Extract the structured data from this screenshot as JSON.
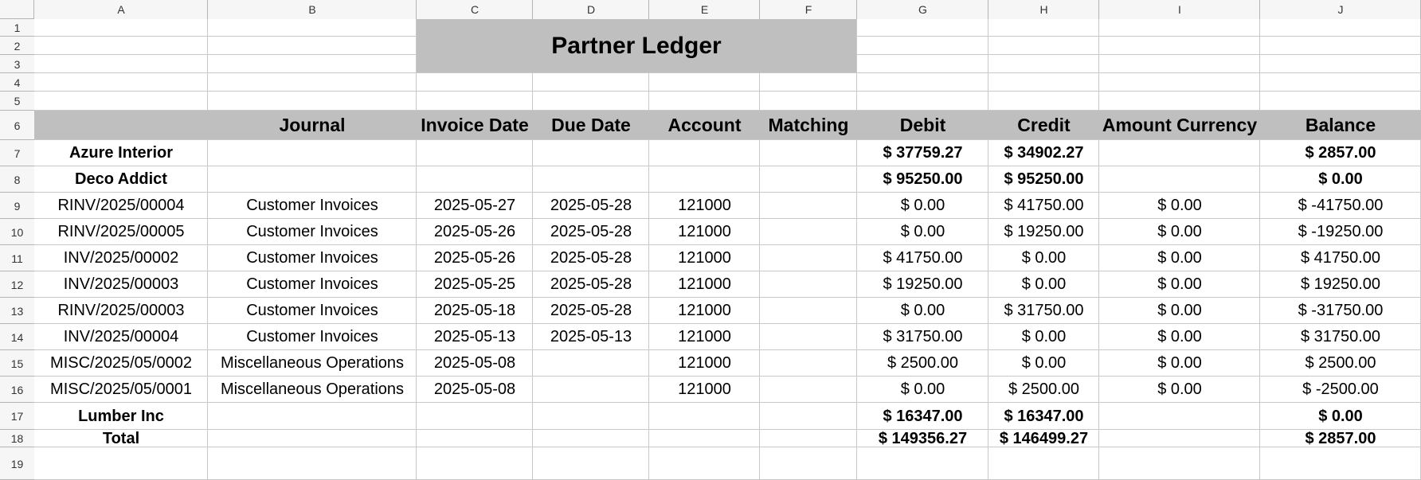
{
  "sheet": {
    "column_headers": [
      "A",
      "B",
      "C",
      "D",
      "E",
      "F",
      "G",
      "H",
      "I",
      "J"
    ],
    "row_numbers": [
      "1",
      "2",
      "3",
      "4",
      "5",
      "6",
      "7",
      "8",
      "9",
      "10",
      "11",
      "12",
      "13",
      "14",
      "15",
      "16",
      "17",
      "18",
      "19"
    ]
  },
  "report": {
    "title": "Partner Ledger",
    "columns": [
      "",
      "Journal",
      "Invoice Date",
      "Due Date",
      "Account",
      "Matching",
      "Debit",
      "Credit",
      "Amount Currency",
      "Balance"
    ],
    "rows": [
      {
        "kind": "partner",
        "cells": [
          "Azure Interior",
          "",
          "",
          "",
          "",
          "",
          "$ 37759.27",
          "$ 34902.27",
          "",
          "$ 2857.00"
        ]
      },
      {
        "kind": "partner",
        "cells": [
          "Deco Addict",
          "",
          "",
          "",
          "",
          "",
          "$ 95250.00",
          "$ 95250.00",
          "",
          "$ 0.00"
        ]
      },
      {
        "kind": "line",
        "cells": [
          "RINV/2025/00004",
          "Customer Invoices",
          "2025-05-27",
          "2025-05-28",
          "121000",
          "",
          "$ 0.00",
          "$ 41750.00",
          "$ 0.00",
          "$ -41750.00"
        ]
      },
      {
        "kind": "line",
        "cells": [
          "RINV/2025/00005",
          "Customer Invoices",
          "2025-05-26",
          "2025-05-28",
          "121000",
          "",
          "$ 0.00",
          "$ 19250.00",
          "$ 0.00",
          "$ -19250.00"
        ]
      },
      {
        "kind": "line",
        "cells": [
          "INV/2025/00002",
          "Customer Invoices",
          "2025-05-26",
          "2025-05-28",
          "121000",
          "",
          "$ 41750.00",
          "$ 0.00",
          "$ 0.00",
          "$ 41750.00"
        ]
      },
      {
        "kind": "line",
        "cells": [
          "INV/2025/00003",
          "Customer Invoices",
          "2025-05-25",
          "2025-05-28",
          "121000",
          "",
          "$ 19250.00",
          "$ 0.00",
          "$ 0.00",
          "$ 19250.00"
        ]
      },
      {
        "kind": "line",
        "cells": [
          "RINV/2025/00003",
          "Customer Invoices",
          "2025-05-18",
          "2025-05-28",
          "121000",
          "",
          "$ 0.00",
          "$ 31750.00",
          "$ 0.00",
          "$ -31750.00"
        ]
      },
      {
        "kind": "line",
        "cells": [
          "INV/2025/00004",
          "Customer Invoices",
          "2025-05-13",
          "2025-05-13",
          "121000",
          "",
          "$ 31750.00",
          "$ 0.00",
          "$ 0.00",
          "$ 31750.00"
        ]
      },
      {
        "kind": "line",
        "cells": [
          "MISC/2025/05/0002",
          "Miscellaneous Operations",
          "2025-05-08",
          "",
          "121000",
          "",
          "$ 2500.00",
          "$ 0.00",
          "$ 0.00",
          "$ 2500.00"
        ]
      },
      {
        "kind": "line",
        "cells": [
          "MISC/2025/05/0001",
          "Miscellaneous Operations",
          "2025-05-08",
          "",
          "121000",
          "",
          "$ 0.00",
          "$ 2500.00",
          "$ 0.00",
          "$ -2500.00"
        ]
      },
      {
        "kind": "partner",
        "cells": [
          "Lumber Inc",
          "",
          "",
          "",
          "",
          "",
          "$ 16347.00",
          "$ 16347.00",
          "",
          "$ 0.00"
        ]
      },
      {
        "kind": "total",
        "cells": [
          "Total",
          "",
          "",
          "",
          "",
          "",
          "$ 149356.27",
          "$ 146499.27",
          "",
          "$ 2857.00"
        ]
      }
    ]
  }
}
